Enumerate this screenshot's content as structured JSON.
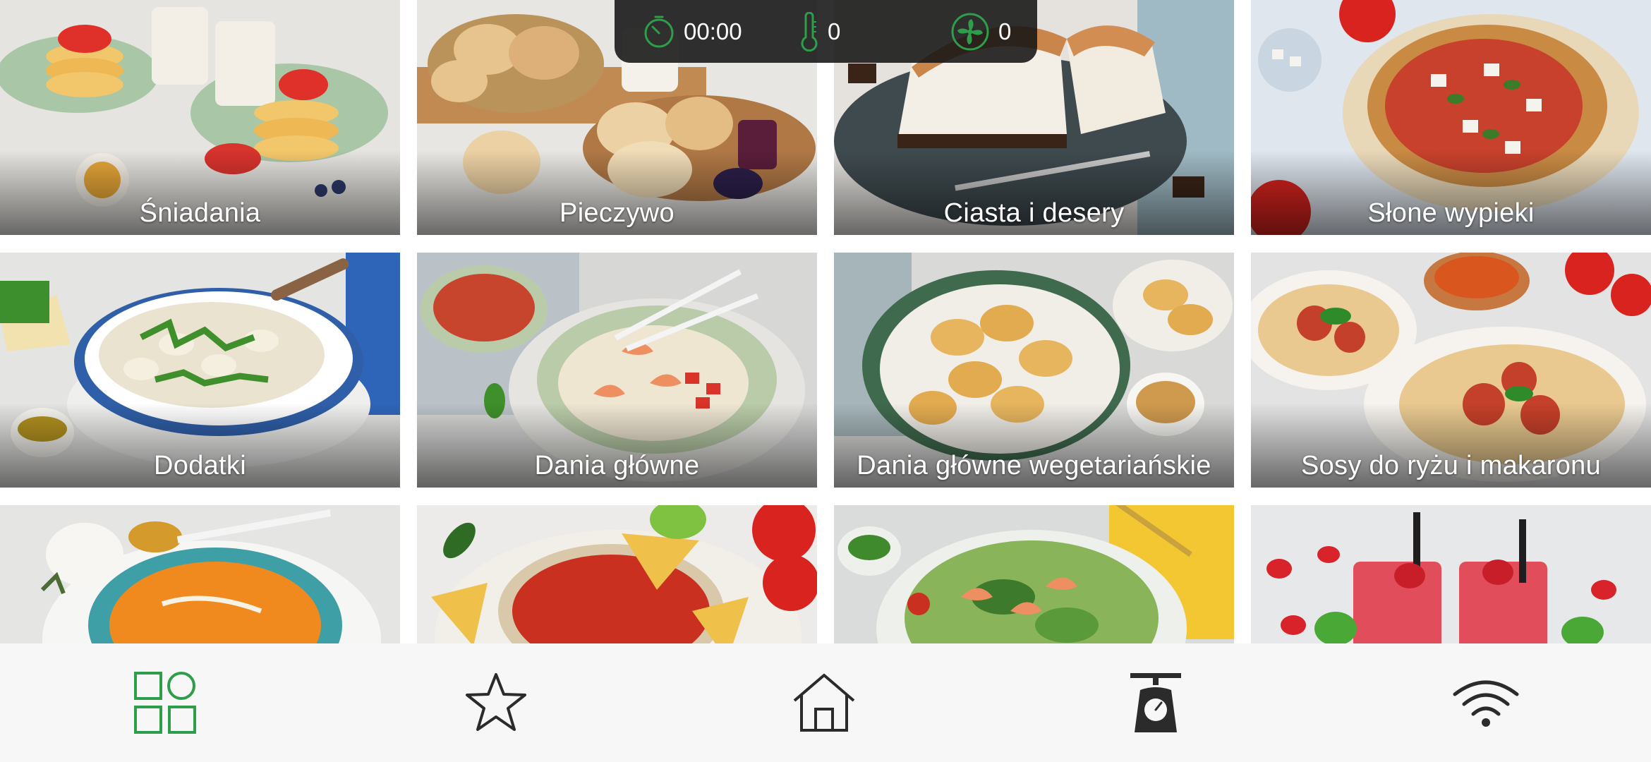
{
  "status_bar": {
    "timer": {
      "icon": "timer-icon",
      "value": "00:00"
    },
    "temperature": {
      "icon": "thermometer-icon",
      "value": "0"
    },
    "speed": {
      "icon": "fan-icon",
      "value": "0"
    }
  },
  "categories": [
    {
      "label": "Śniadania",
      "photo": "pancakes-photo"
    },
    {
      "label": "Pieczywo",
      "photo": "bread-rolls-photo"
    },
    {
      "label": "Ciasta i desery",
      "photo": "meringue-cake-photo"
    },
    {
      "label": "Słone wypieki",
      "photo": "savory-galette-photo"
    },
    {
      "label": "Dodatki",
      "photo": "gnocchi-salad-photo"
    },
    {
      "label": "Dania główne",
      "photo": "shrimp-risotto-photo"
    },
    {
      "label": "Dania główne wegetariańskie",
      "photo": "dumplings-photo"
    },
    {
      "label": "Sosy do ryżu i makaronu",
      "photo": "spaghetti-meatballs-photo"
    },
    {
      "label": "",
      "photo": "pumpkin-soup-photo"
    },
    {
      "label": "",
      "photo": "salsa-nachos-photo"
    },
    {
      "label": "",
      "photo": "shrimp-salad-photo"
    },
    {
      "label": "",
      "photo": "strawberry-drink-photo"
    }
  ],
  "bottom_nav": [
    {
      "name": "categories",
      "icon": "grid-icon",
      "active": true
    },
    {
      "name": "favorites",
      "icon": "star-icon",
      "active": false
    },
    {
      "name": "home",
      "icon": "home-icon",
      "active": false
    },
    {
      "name": "scale",
      "icon": "kitchen-scale-icon",
      "active": false
    },
    {
      "name": "wifi",
      "icon": "wifi-icon",
      "active": false
    }
  ],
  "colors": {
    "accent_green": "#2e9e4a",
    "status_bg": "#141414",
    "nav_bg": "#f7f7f7",
    "icon_dark": "#2b2b2b"
  }
}
